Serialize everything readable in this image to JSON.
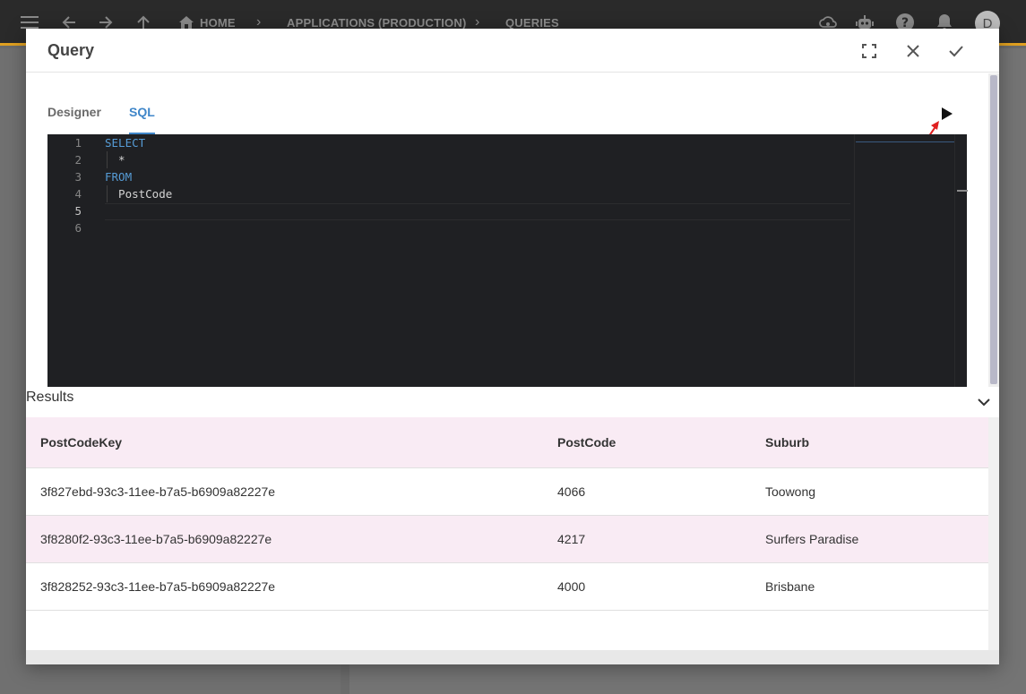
{
  "topbar": {
    "breadcrumbs": [
      {
        "label": "HOME"
      },
      {
        "label": "APPLICATIONS (PRODUCTION)"
      },
      {
        "label": "QUERIES"
      }
    ],
    "avatar_letter": "D",
    "icons": [
      "menu-icon",
      "back-icon",
      "forward-icon",
      "up-icon",
      "home-icon",
      "cloud-settings-icon",
      "robot-icon",
      "help-icon",
      "bell-icon"
    ]
  },
  "dialog": {
    "title": "Query",
    "tabs": [
      {
        "label": "Designer",
        "active": false
      },
      {
        "label": "SQL",
        "active": true
      }
    ]
  },
  "editor": {
    "line_numbers": [
      "1",
      "2",
      "3",
      "4",
      "5",
      "6"
    ],
    "lines": [
      {
        "text": "SELECT",
        "keyword": true
      },
      {
        "text": "  *",
        "keyword": false
      },
      {
        "text": "FROM",
        "keyword": true
      },
      {
        "text": "  PostCode",
        "keyword": false
      },
      {
        "text": "",
        "keyword": false
      },
      {
        "text": "",
        "keyword": false
      }
    ]
  },
  "results": {
    "title": "Results",
    "columns": [
      "PostCodeKey",
      "PostCode",
      "Suburb"
    ],
    "rows": [
      [
        "3f827ebd-93c3-11ee-b7a5-b6909a82227e",
        "4066",
        "Toowong"
      ],
      [
        "3f8280f2-93c3-11ee-b7a5-b6909a82227e",
        "4217",
        "Surfers Paradise"
      ],
      [
        "3f828252-93c3-11ee-b7a5-b6909a82227e",
        "4000",
        "Brisbane"
      ]
    ]
  },
  "colors": {
    "accent": "#3f86c9",
    "keyword": "#569cd6",
    "editor_bg": "#1f2023",
    "row_alt": "#f9ebf4",
    "topbar_border": "#e0a020"
  }
}
